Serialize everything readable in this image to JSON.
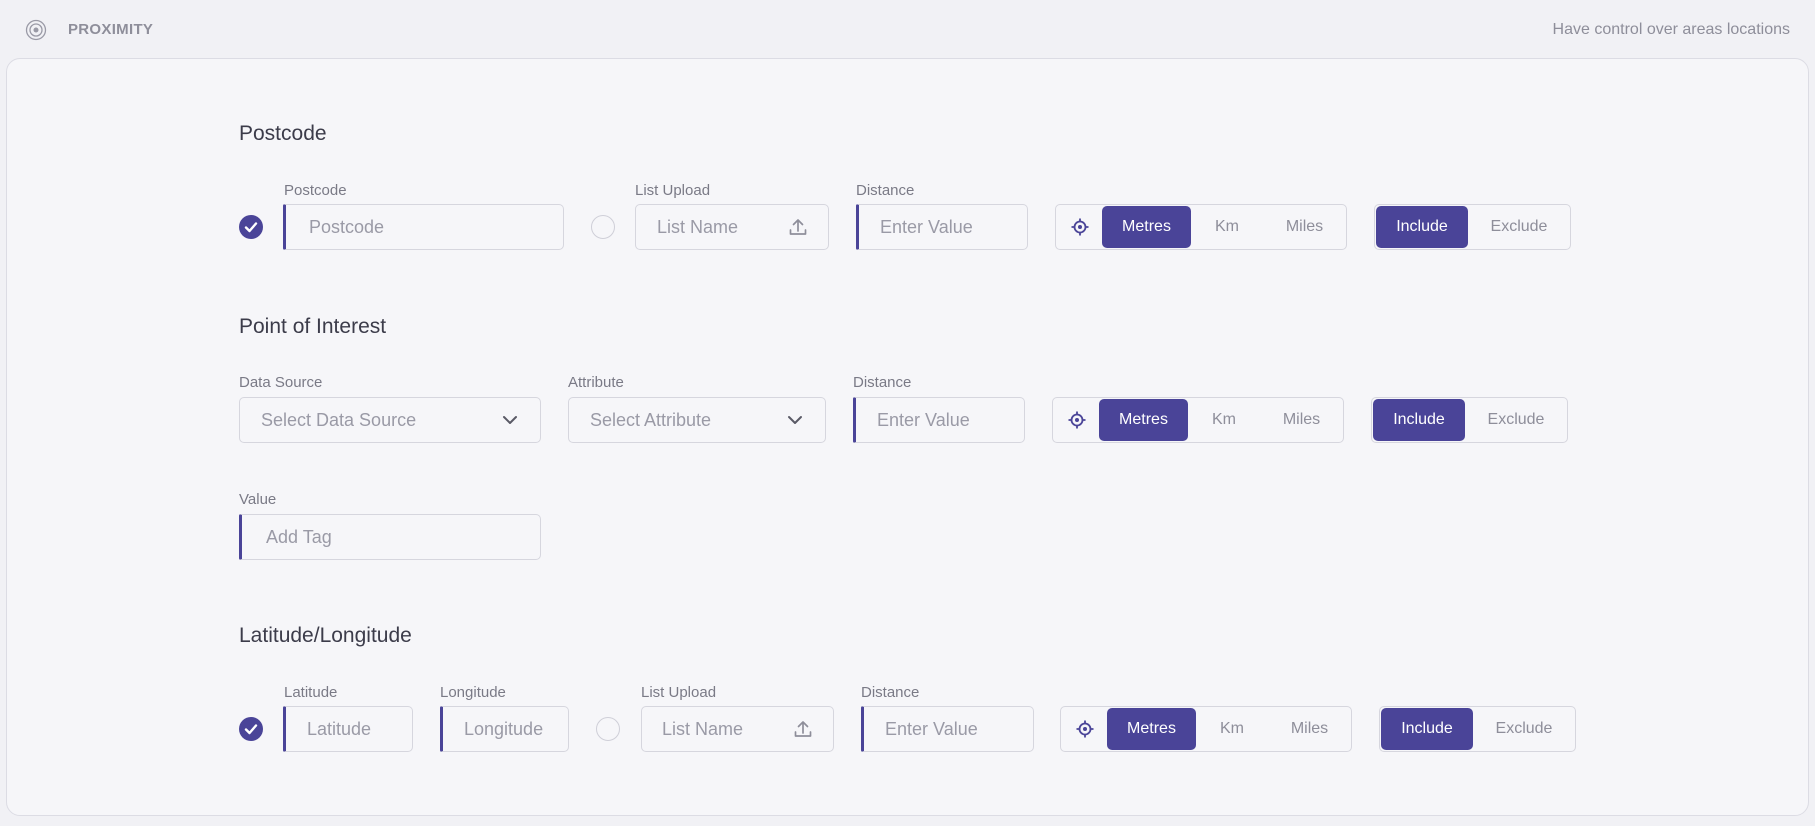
{
  "header": {
    "brand": "PROXIMITY",
    "tagline": "Have control over areas locations",
    "logo_icon": "target-circle-icon"
  },
  "colors": {
    "accent": "#4a4498",
    "muted": "#8e8e9a"
  },
  "postcode_section": {
    "title": "Postcode",
    "postcode_label": "Postcode",
    "postcode_placeholder": "Postcode",
    "list_upload_label": "List Upload",
    "list_name_placeholder": "List Name",
    "distance_label": "Distance",
    "distance_placeholder": "Enter Value",
    "units": [
      "Metres",
      "Km",
      "Miles"
    ],
    "selected_unit": "Metres",
    "modes": [
      "Include",
      "Exclude"
    ],
    "selected_mode": "Include"
  },
  "poi_section": {
    "title": "Point of Interest",
    "data_source_label": "Data Source",
    "data_source_placeholder": "Select Data Source",
    "attribute_label": "Attribute",
    "attribute_placeholder": "Select Attribute",
    "distance_label": "Distance",
    "distance_placeholder": "Enter Value",
    "units": [
      "Metres",
      "Km",
      "Miles"
    ],
    "selected_unit": "Metres",
    "modes": [
      "Include",
      "Exclude"
    ],
    "selected_mode": "Include",
    "value_label": "Value",
    "value_placeholder": "Add Tag"
  },
  "latlng_section": {
    "title": "Latitude/Longitude",
    "latitude_label": "Latitude",
    "latitude_placeholder": "Latitude",
    "longitude_label": "Longitude",
    "longitude_placeholder": "Longitude",
    "list_upload_label": "List Upload",
    "list_name_placeholder": "List Name",
    "distance_label": "Distance",
    "distance_placeholder": "Enter Value",
    "units": [
      "Metres",
      "Km",
      "Miles"
    ],
    "selected_unit": "Metres",
    "modes": [
      "Include",
      "Exclude"
    ],
    "selected_mode": "Include"
  }
}
